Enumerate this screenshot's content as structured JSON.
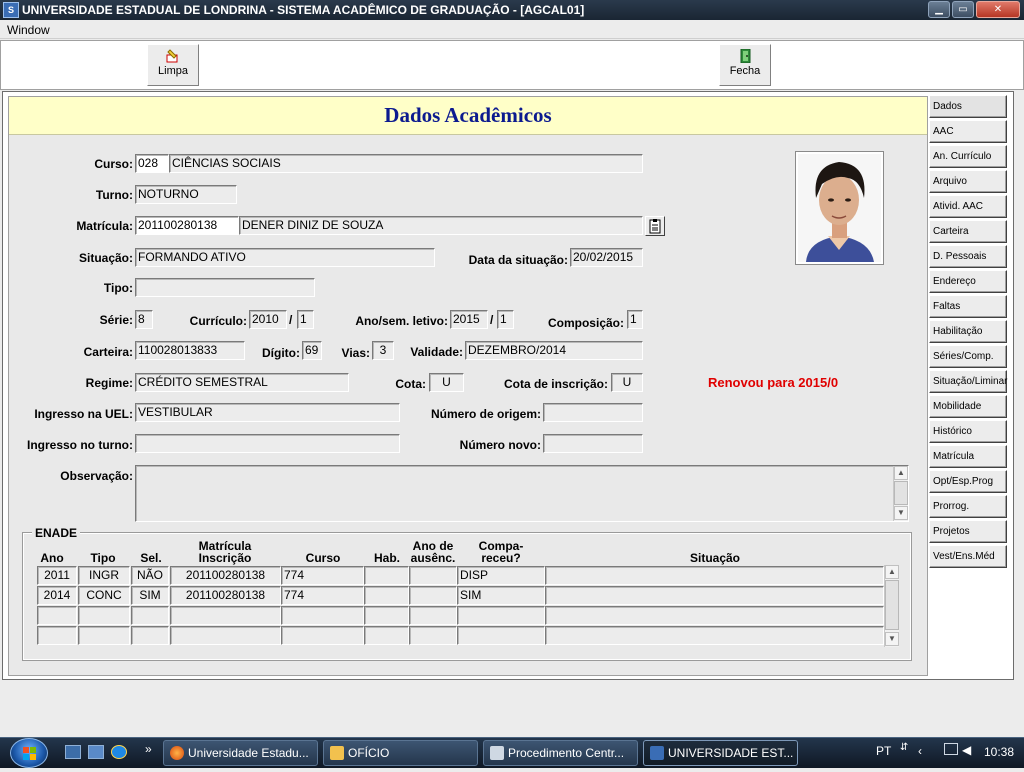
{
  "window": {
    "title": "UNIVERSIDADE ESTADUAL DE LONDRINA - SISTEMA ACADÊMICO DE GRADUAÇÃO - [AGCAL01]",
    "app_icon_text": "S",
    "minimize": "▁",
    "maximize": "▭",
    "close": "✕"
  },
  "menu": {
    "window": "Window"
  },
  "toolbar": {
    "limpa": "Limpa",
    "fecha": "Fecha"
  },
  "page_title": "Dados Acadêmicos",
  "form": {
    "curso_label": "Curso:",
    "curso_codigo": "028",
    "curso_nome": "CIÊNCIAS SOCIAIS",
    "turno_label": "Turno:",
    "turno": "NOTURNO",
    "matricula_label": "Matrícula:",
    "matricula": "201100280138",
    "nome": "DENER DINIZ DE SOUZA",
    "situacao_label": "Situação:",
    "situacao": "FORMANDO ATIVO",
    "data_situacao_label": "Data da situação:",
    "data_situacao": "20/02/2015",
    "tipo_label": "Tipo:",
    "tipo": "",
    "serie_label": "Série:",
    "serie": "8",
    "curriculo_label": "Currículo:",
    "curriculo_ano": "2010",
    "curriculo_num": "1",
    "ano_sem_label": "Ano/sem. letivo:",
    "ano_letivo": "2015",
    "sem_letivo": "1",
    "composicao_label": "Composição:",
    "composicao": "1",
    "carteira_label": "Carteira:",
    "carteira": "110028013833",
    "digito_label": "Dígito:",
    "digito": "69",
    "vias_label": "Vias:",
    "vias": "3",
    "validade_label": "Validade:",
    "validade": "DEZEMBRO/2014",
    "regime_label": "Regime:",
    "regime": "CRÉDITO SEMESTRAL",
    "cota_label": "Cota:",
    "cota": "U",
    "cota_inscricao_label": "Cota de inscrição:",
    "cota_inscricao": "U",
    "renovou": "Renovou para 2015/0",
    "ingresso_uel_label": "Ingresso na UEL:",
    "ingresso_uel": "VESTIBULAR",
    "numero_origem_label": "Número de origem:",
    "numero_origem": "",
    "ingresso_turno_label": "Ingresso no turno:",
    "ingresso_turno": "",
    "numero_novo_label": "Número novo:",
    "numero_novo": "",
    "observacao_label": "Observação:",
    "observacao": ""
  },
  "enade": {
    "legend": "ENADE",
    "headers": {
      "ano": "Ano",
      "tipo": "Tipo",
      "sel": "Sel.",
      "matricula_l1": "Matrícula",
      "matricula_l2": "Inscrição",
      "curso": "Curso",
      "hab": "Hab.",
      "ausencia_l1": "Ano de",
      "ausencia_l2": "ausênc.",
      "compareceu_l1": "Compa-",
      "compareceu_l2": "receu?",
      "situacao": "Situação"
    },
    "rows": [
      {
        "ano": "2011",
        "tipo": "INGR",
        "sel": "NÃO",
        "matricula": "201100280138",
        "curso": "774",
        "hab": "",
        "ausencia": "",
        "compareceu": "DISP",
        "situacao": ""
      },
      {
        "ano": "2014",
        "tipo": "CONC",
        "sel": "SIM",
        "matricula": "201100280138",
        "curso": "774",
        "hab": "",
        "ausencia": "",
        "compareceu": "SIM",
        "situacao": ""
      },
      {
        "ano": "",
        "tipo": "",
        "sel": "",
        "matricula": "",
        "curso": "",
        "hab": "",
        "ausencia": "",
        "compareceu": "",
        "situacao": ""
      },
      {
        "ano": "",
        "tipo": "",
        "sel": "",
        "matricula": "",
        "curso": "",
        "hab": "",
        "ausencia": "",
        "compareceu": "",
        "situacao": ""
      }
    ]
  },
  "nav": [
    "Dados",
    "AAC",
    "An. Currículo",
    "Arquivo",
    "Ativid. AAC",
    "Carteira",
    "D. Pessoais",
    "Endereço",
    "Faltas",
    "Habilitação",
    "Séries/Comp.",
    "Situação/Liminar",
    "Mobilidade",
    "Histórico",
    "Matrícula",
    "Opt/Esp.Prog",
    "Prorrog.",
    "Projetos",
    "Vest/Ens.Méd"
  ],
  "taskbar": {
    "tasks": [
      "Universidade Estadu...",
      "OFÍCIO",
      "Procedimento Centr...",
      "UNIVERSIDADE EST..."
    ],
    "more": "»",
    "lang": "PT",
    "clock": "10:38"
  },
  "colors": {
    "title_blue": "#0c1a8f",
    "header_yellow": "#ffffc8",
    "renew_red": "#e00000"
  }
}
